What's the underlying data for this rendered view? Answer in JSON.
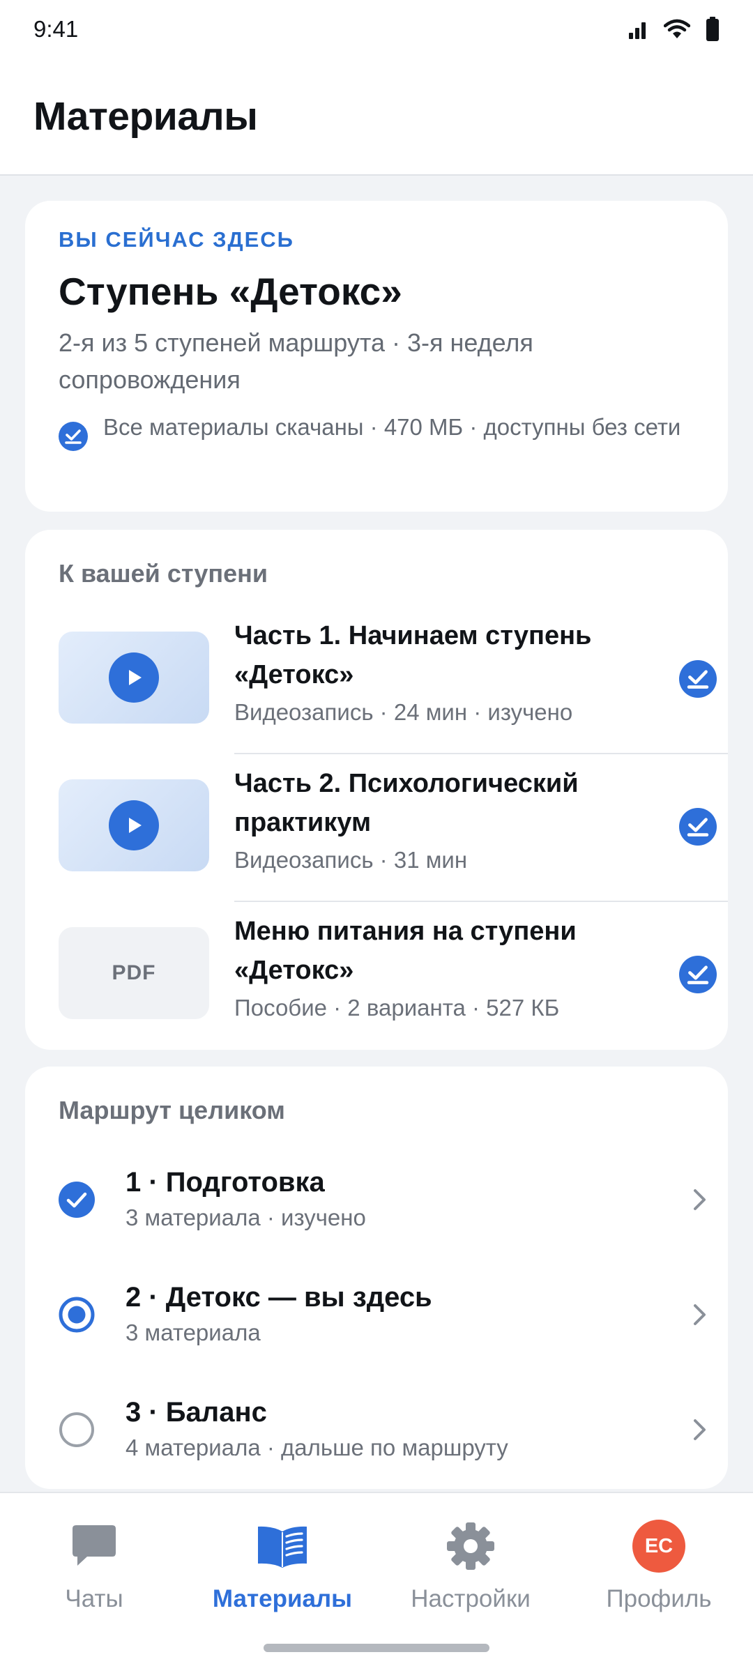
{
  "status_bar": {
    "time": "9:41"
  },
  "header": {
    "title": "Материалы"
  },
  "current": {
    "eyebrow": "ВЫ СЕЙЧАС ЗДЕСЬ",
    "title": "Ступень «Детокс»",
    "subtitle": "2-я из 5 ступеней маршрута · 3-я неделя сопровождения",
    "offline": "Все материалы скачаны · 470 МБ · доступны без сети"
  },
  "stage_materials": {
    "title": "К вашей ступени",
    "items": [
      {
        "title": "Часть 1. Начинаем ступень «Детокс»",
        "meta": "Видеозапись · 24 мин · изучено",
        "kind": "video"
      },
      {
        "title": "Часть 2. Психологический практикум",
        "meta": "Видеозапись · 31 мин",
        "kind": "video"
      },
      {
        "title": "Меню питания на ступени «Детокс»",
        "meta": "Пособие · 2 варианта · 527 КБ",
        "kind": "pdf",
        "thumb_label": "PDF"
      }
    ]
  },
  "route": {
    "title": "Маршрут целиком",
    "items": [
      {
        "title": "1 · Подготовка",
        "meta": "3 материала · изучено",
        "state": "done"
      },
      {
        "title": "2 · Детокс — вы здесь",
        "meta": "3 материала",
        "state": "current"
      },
      {
        "title": "3 · Баланс",
        "meta": "4 материала · дальше по маршруту",
        "state": "upcoming"
      }
    ]
  },
  "nav": {
    "items": [
      {
        "label": "Чаты",
        "icon": "chat-icon",
        "active": false
      },
      {
        "label": "Материалы",
        "icon": "book-icon",
        "active": true
      },
      {
        "label": "Настройки",
        "icon": "gear-icon",
        "active": false
      },
      {
        "label": "Профиль",
        "icon": "avatar",
        "initials": "ЕС",
        "active": false
      }
    ]
  },
  "colors": {
    "accent": "#2e6fd9",
    "eyebrow": "#2a6fd1",
    "avatar": "#ee5a3f",
    "muted": "#6b7079",
    "background": "#f1f3f6"
  }
}
